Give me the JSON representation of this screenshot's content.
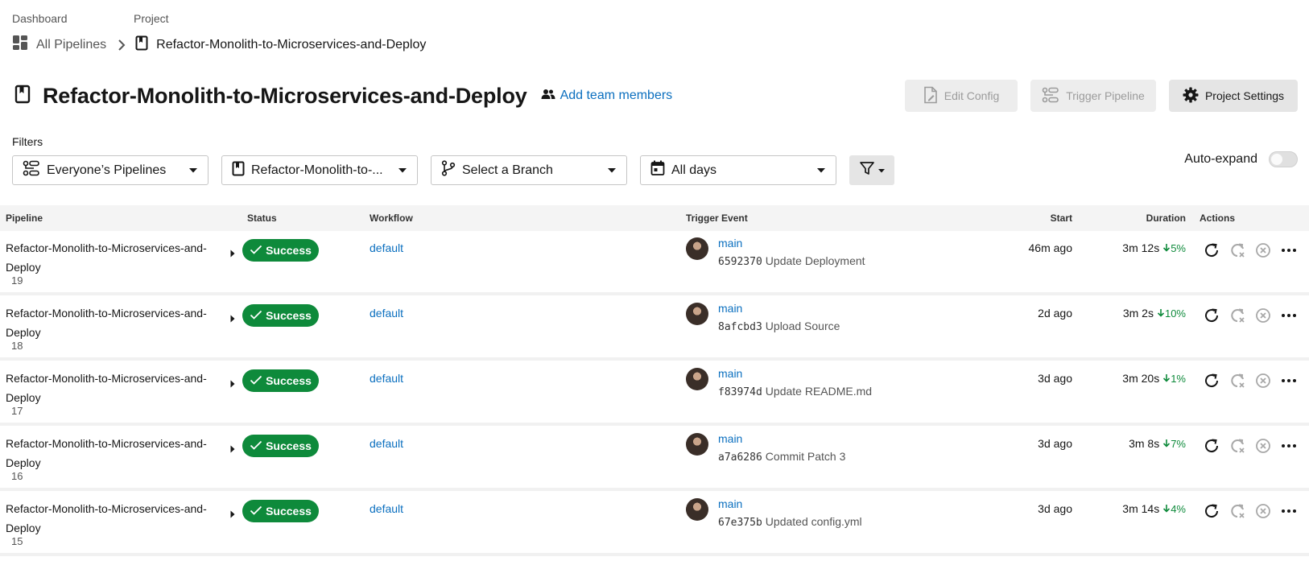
{
  "breadcrumb": {
    "dashboard_label": "Dashboard",
    "project_label": "Project",
    "all_pipelines": "All Pipelines",
    "current": "Refactor-Monolith-to-Microservices-and-Deploy"
  },
  "header": {
    "title": "Refactor-Monolith-to-Microservices-and-Deploy",
    "add_team": "Add team members",
    "edit_config": "Edit Config",
    "trigger_pipeline": "Trigger Pipeline",
    "project_settings": "Project Settings"
  },
  "filters": {
    "label": "Filters",
    "pipelines": "Everyone’s Pipelines",
    "project": "Refactor-Monolith-to-...",
    "branch": "Select a Branch",
    "days": "All days",
    "auto_expand": "Auto-expand"
  },
  "table": {
    "headers": {
      "pipeline": "Pipeline",
      "status": "Status",
      "workflow": "Workflow",
      "trigger": "Trigger Event",
      "start": "Start",
      "duration": "Duration",
      "actions": "Actions"
    },
    "rows": [
      {
        "name": "Refactor-Monolith-to-Microservices-and-Deploy",
        "number": "19",
        "status": "Success",
        "workflow": "default",
        "branch": "main",
        "sha": "6592370",
        "message": "Update Deployment",
        "start": "46m ago",
        "duration": "3m 12s",
        "change": "5%"
      },
      {
        "name": "Refactor-Monolith-to-Microservices-and-Deploy",
        "number": "18",
        "status": "Success",
        "workflow": "default",
        "branch": "main",
        "sha": "8afcbd3",
        "message": "Upload Source",
        "start": "2d ago",
        "duration": "3m 2s",
        "change": "10%"
      },
      {
        "name": "Refactor-Monolith-to-Microservices-and-Deploy",
        "number": "17",
        "status": "Success",
        "workflow": "default",
        "branch": "main",
        "sha": "f83974d",
        "message": "Update README.md",
        "start": "3d ago",
        "duration": "3m 20s",
        "change": "1%"
      },
      {
        "name": "Refactor-Monolith-to-Microservices-and-Deploy",
        "number": "16",
        "status": "Success",
        "workflow": "default",
        "branch": "main",
        "sha": "a7a6286",
        "message": "Commit Patch 3",
        "start": "3d ago",
        "duration": "3m 8s",
        "change": "7%"
      },
      {
        "name": "Refactor-Monolith-to-Microservices-and-Deploy",
        "number": "15",
        "status": "Success",
        "workflow": "default",
        "branch": "main",
        "sha": "67e375b",
        "message": "Updated config.yml",
        "start": "3d ago",
        "duration": "3m 14s",
        "change": "4%"
      }
    ]
  },
  "colors": {
    "success": "#0e8a3b",
    "link": "#0b6fbf"
  }
}
